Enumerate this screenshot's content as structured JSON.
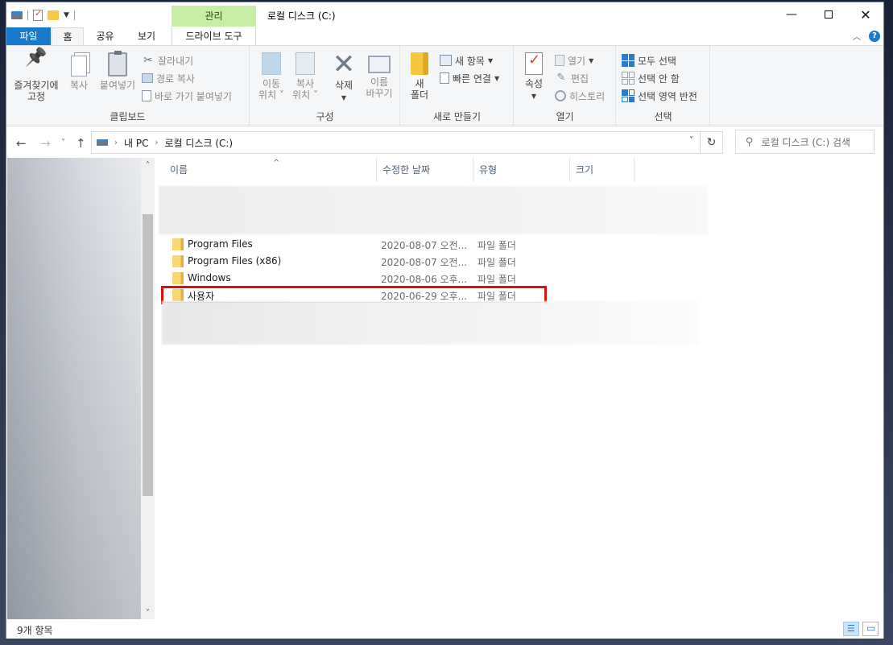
{
  "window": {
    "title": "로컬 디스크 (C:)",
    "contextual_tab_group": "관리",
    "controls": [
      "—",
      "",
      "✕"
    ]
  },
  "ribbon_tabs": {
    "file": "파일",
    "home": "홈",
    "share": "공유",
    "view": "보기",
    "drive_tools": "드라이브 도구"
  },
  "ribbon": {
    "clipboard": {
      "label": "클립보드",
      "pin": [
        "즐겨찾기에",
        "고정"
      ],
      "copy": "복사",
      "paste": "붙여넣기",
      "cut": "잘라내기",
      "copy_path": "경로 복사",
      "paste_shortcut": "바로 가기 붙여넣기"
    },
    "organize": {
      "label": "구성",
      "move_to": [
        "이동",
        "위치 ˅"
      ],
      "copy_to": [
        "복사",
        "위치 ˅"
      ],
      "delete": "삭제",
      "rename": [
        "이름",
        "바꾸기"
      ]
    },
    "new": {
      "label": "새로 만들기",
      "new_folder": [
        "새",
        "폴더"
      ],
      "new_item": "새 항목",
      "easy_access": "빠른 연결"
    },
    "open": {
      "label": "열기",
      "properties": "속성",
      "open": "열기",
      "edit": "편집",
      "history": "히스토리"
    },
    "select": {
      "label": "선택",
      "select_all": "모두 선택",
      "select_none": "선택 안 함",
      "invert": "선택 영역 반전"
    }
  },
  "address": {
    "crumbs": [
      "내 PC",
      "로컬 디스크 (C:)"
    ],
    "search_placeholder": "로컬 디스크 (C:) 검색"
  },
  "columns": {
    "name": "이름",
    "date": "수정한 날짜",
    "type": "유형",
    "size": "크기"
  },
  "files": [
    {
      "name": "Program Files",
      "date": "2020-08-07 오전...",
      "type": "파일 폴더"
    },
    {
      "name": "Program Files (x86)",
      "date": "2020-08-07 오전...",
      "type": "파일 폴더"
    },
    {
      "name": "Windows",
      "date": "2020-08-06 오후...",
      "type": "파일 폴더"
    },
    {
      "name": "사용자",
      "date": "2020-06-29 오후...",
      "type": "파일 폴더"
    }
  ],
  "status": {
    "item_count": "9개 항목"
  },
  "colors": {
    "file_tab": "#1979ca",
    "contextual_tab": "#c6efa5",
    "highlight": "#e00d0d"
  }
}
